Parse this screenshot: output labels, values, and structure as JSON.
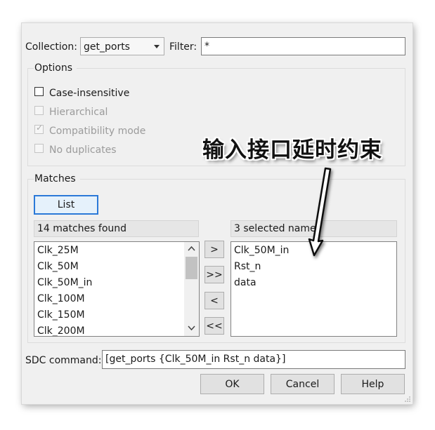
{
  "collection": {
    "label": "Collection:",
    "value": "get_ports"
  },
  "filter": {
    "label": "Filter:",
    "value": "*"
  },
  "options": {
    "title": "Options",
    "case_insensitive": "Case-insensitive",
    "hierarchical": "Hierarchical",
    "compatibility_mode": "Compatibility mode",
    "no_duplicates": "No duplicates"
  },
  "matches": {
    "title": "Matches",
    "list_button": "List",
    "found_header": "14 matches found",
    "found_items": [
      "Clk_25M",
      "Clk_50M",
      "Clk_50M_in",
      "Clk_100M",
      "Clk_150M",
      "Clk_200M"
    ],
    "selected_header": "3 selected names",
    "selected_items": [
      "Clk_50M_in",
      "Rst_n",
      "data"
    ],
    "add_button": ">",
    "add_all_button": ">>",
    "remove_button": "<",
    "remove_all_button": "<<"
  },
  "sdc": {
    "label": "SDC command:",
    "value": "[get_ports {Clk_50M_in Rst_n data}]"
  },
  "buttons": {
    "ok": "OK",
    "cancel": "Cancel",
    "help": "Help"
  },
  "annotation": {
    "text": "输入接口延时约束"
  }
}
